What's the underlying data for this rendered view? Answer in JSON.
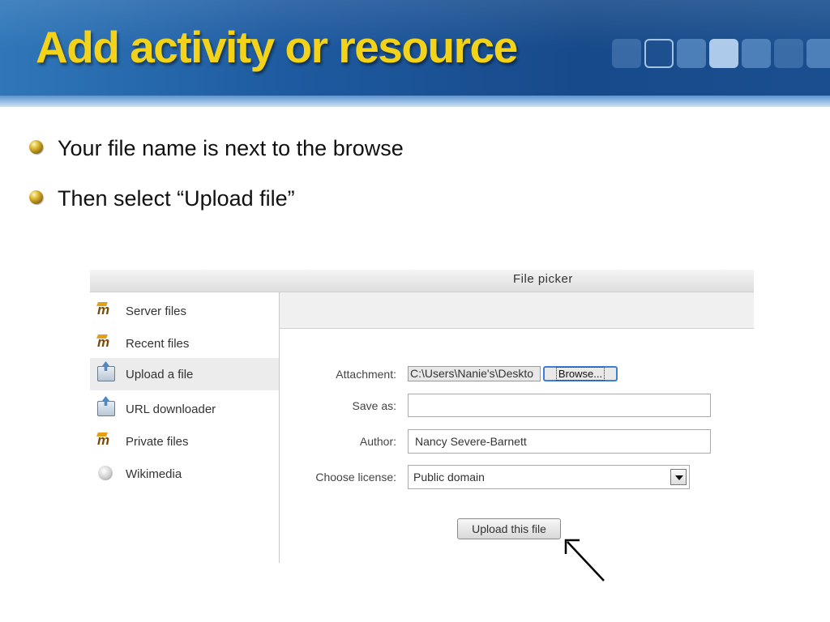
{
  "slide": {
    "title": "Add activity or resource",
    "bullets": [
      "Your file name is next to the browse",
      "Then select “Upload file”"
    ]
  },
  "file_picker": {
    "title": "File picker",
    "repositories": [
      {
        "label": "Server files",
        "icon": "moodle-icon"
      },
      {
        "label": "Recent files",
        "icon": "moodle-icon"
      },
      {
        "label": "Upload a file",
        "icon": "upload-icon",
        "selected": true
      },
      {
        "label": "URL downloader",
        "icon": "upload-icon"
      },
      {
        "label": "Private files",
        "icon": "moodle-icon"
      },
      {
        "label": "Wikimedia",
        "icon": "wikimedia-icon"
      }
    ],
    "form": {
      "attachment_label": "Attachment:",
      "attachment_value": "C:\\Users\\Nanie's\\Deskto",
      "browse_label": "Browse...",
      "save_as_label": "Save as:",
      "save_as_value": "",
      "author_label": "Author:",
      "author_value": "Nancy Severe-Barnett",
      "license_label": "Choose license:",
      "license_value": "Public domain",
      "upload_button": "Upload this file"
    }
  },
  "colors": {
    "title": "#f3d21a",
    "header": "#1e5aa0",
    "browse_focus": "#3c7fd8"
  }
}
